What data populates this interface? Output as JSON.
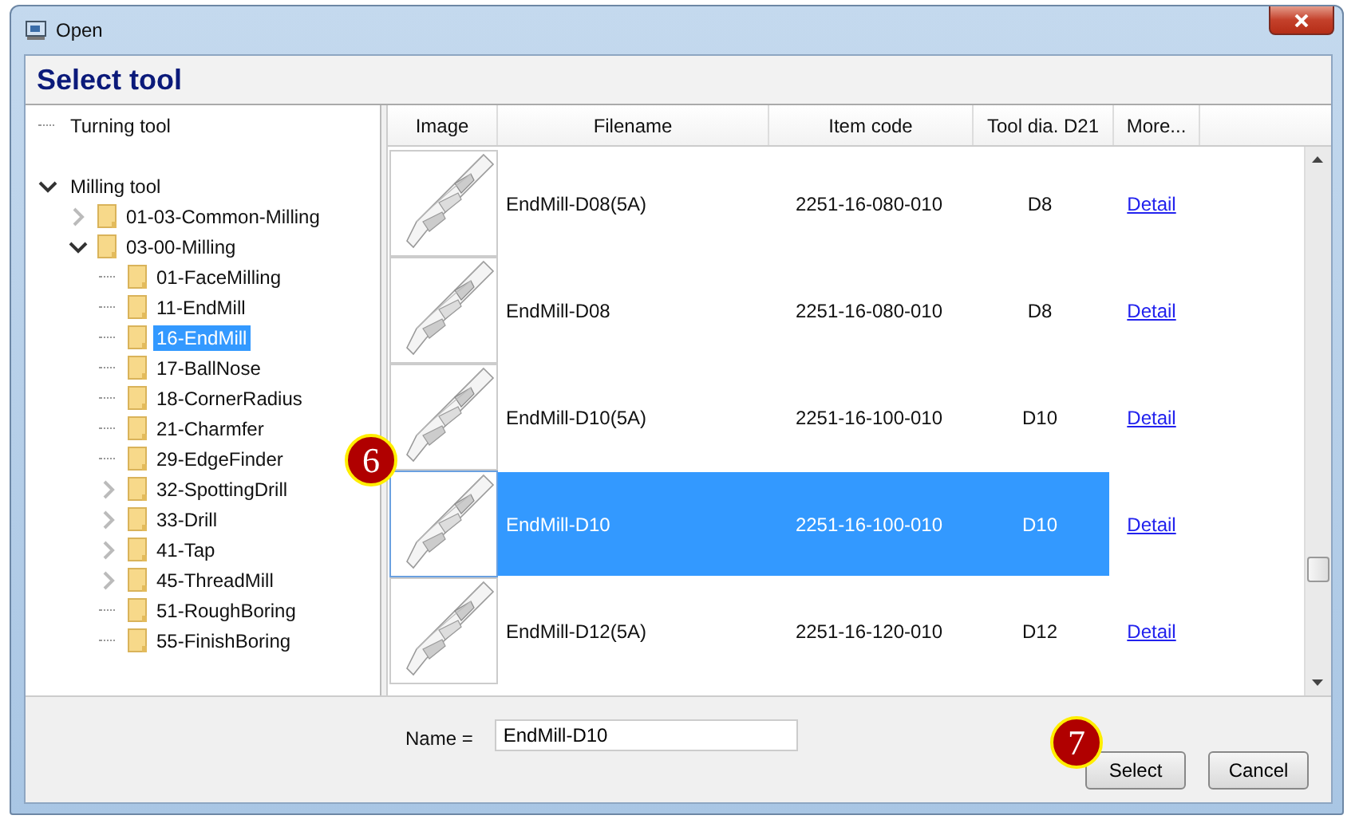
{
  "window": {
    "title": "Open"
  },
  "header": {
    "title": "Select tool"
  },
  "tree": [
    {
      "label": "Turning tool",
      "kind": "leaf",
      "selected": false
    },
    {
      "label": "Milling tool",
      "kind": "branch",
      "expanded": true,
      "selected": false,
      "children": [
        {
          "label": "01-03-Common-Milling",
          "kind": "branch",
          "expanded": false,
          "selected": false
        },
        {
          "label": "03-00-Milling",
          "kind": "branch",
          "expanded": true,
          "selected": false,
          "children": [
            {
              "label": "01-FaceMilling",
              "kind": "leaf",
              "selected": false
            },
            {
              "label": "11-EndMill",
              "kind": "leaf",
              "selected": false
            },
            {
              "label": "16-EndMill",
              "kind": "leaf",
              "selected": true
            },
            {
              "label": "17-BallNose",
              "kind": "leaf",
              "selected": false
            },
            {
              "label": "18-CornerRadius",
              "kind": "leaf",
              "selected": false
            },
            {
              "label": "21-Charmfer",
              "kind": "leaf",
              "selected": false
            },
            {
              "label": "29-EdgeFinder",
              "kind": "leaf",
              "selected": false
            },
            {
              "label": "32-SpottingDrill",
              "kind": "branch",
              "expanded": false,
              "selected": false
            },
            {
              "label": "33-Drill",
              "kind": "branch",
              "expanded": false,
              "selected": false
            },
            {
              "label": "41-Tap",
              "kind": "branch",
              "expanded": false,
              "selected": false
            },
            {
              "label": "45-ThreadMill",
              "kind": "branch",
              "expanded": false,
              "selected": false
            },
            {
              "label": "51-RoughBoring",
              "kind": "leaf",
              "selected": false
            },
            {
              "label": "55-FinishBoring",
              "kind": "leaf",
              "selected": false
            }
          ]
        }
      ]
    }
  ],
  "table": {
    "columns": [
      "Image",
      "Filename",
      "Item code",
      "Tool dia. D21",
      "More..."
    ],
    "rows": [
      {
        "filename": "EndMill-D08(5A)",
        "item_code": "2251-16-080-010",
        "diameter": "D8",
        "link": "Detail",
        "selected": false
      },
      {
        "filename": "EndMill-D08",
        "item_code": "2251-16-080-010",
        "diameter": "D8",
        "link": "Detail",
        "selected": false
      },
      {
        "filename": "EndMill-D10(5A)",
        "item_code": "2251-16-100-010",
        "diameter": "D10",
        "link": "Detail",
        "selected": false
      },
      {
        "filename": "EndMill-D10",
        "item_code": "2251-16-100-010",
        "diameter": "D10",
        "link": "Detail",
        "selected": true
      },
      {
        "filename": "EndMill-D12(5A)",
        "item_code": "2251-16-120-010",
        "diameter": "D12",
        "link": "Detail",
        "selected": false
      }
    ]
  },
  "name_field": {
    "label": "Name =",
    "value": "EndMill-D10"
  },
  "buttons": [
    "Select",
    "Cancel"
  ],
  "callouts": [
    {
      "label": "6"
    },
    {
      "label": "7"
    }
  ]
}
